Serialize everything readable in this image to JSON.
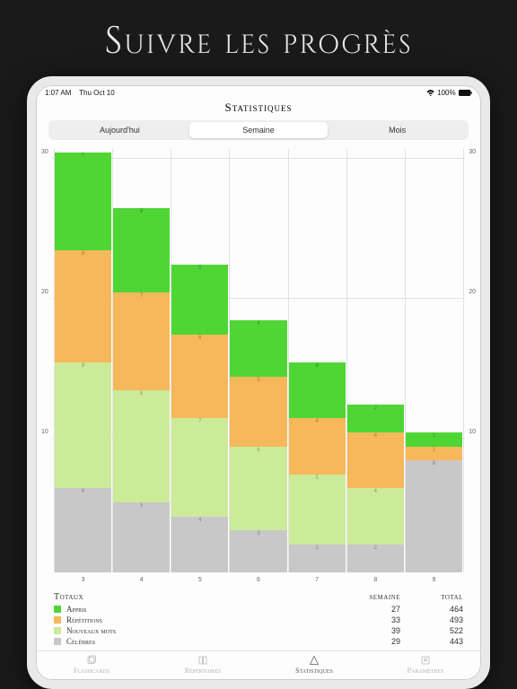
{
  "hero_title": "Suivre les progrès",
  "status": {
    "time": "1:07 AM",
    "date": "Thu Oct 10",
    "battery": "100%"
  },
  "page_title": "Statistiques",
  "segments": {
    "items": [
      "Aujourd'hui",
      "Semaine",
      "Mois"
    ],
    "active": 1
  },
  "chart_data": {
    "type": "bar",
    "stacked": true,
    "ylim": [
      0,
      30
    ],
    "yticks": [
      10,
      20,
      30
    ],
    "categories": [
      "3",
      "4",
      "5",
      "6",
      "7",
      "8",
      "9"
    ],
    "series": [
      {
        "name": "Appris",
        "color": "#4fd635",
        "values": [
          7,
          6,
          5,
          4,
          4,
          2,
          1
        ]
      },
      {
        "name": "Répétitions",
        "color": "#f6b85a",
        "values": [
          8,
          7,
          6,
          5,
          4,
          4,
          1
        ]
      },
      {
        "name": "Nouveaux mots",
        "color": "#cceb99",
        "values": [
          9,
          8,
          7,
          6,
          5,
          4,
          0
        ]
      },
      {
        "name": "Célèbres",
        "color": "#c8c8c8",
        "values": [
          6,
          5,
          4,
          3,
          2,
          2,
          8
        ]
      }
    ]
  },
  "totals": {
    "header": {
      "label": "Totaux",
      "week": "semaine",
      "total": "total"
    },
    "rows": [
      {
        "label": "Appris",
        "color": "#4fd635",
        "week": 27,
        "total": 464
      },
      {
        "label": "Répétitions",
        "color": "#f6b85a",
        "week": 33,
        "total": 493
      },
      {
        "label": "Nouveaux mots",
        "color": "#cceb99",
        "week": 39,
        "total": 522
      },
      {
        "label": "Célèbres",
        "color": "#c8c8c8",
        "week": 29,
        "total": 443
      }
    ]
  },
  "tabs": {
    "items": [
      "Flashcards",
      "Répertoires",
      "Statistiques",
      "Paramètres"
    ],
    "active": 2
  }
}
